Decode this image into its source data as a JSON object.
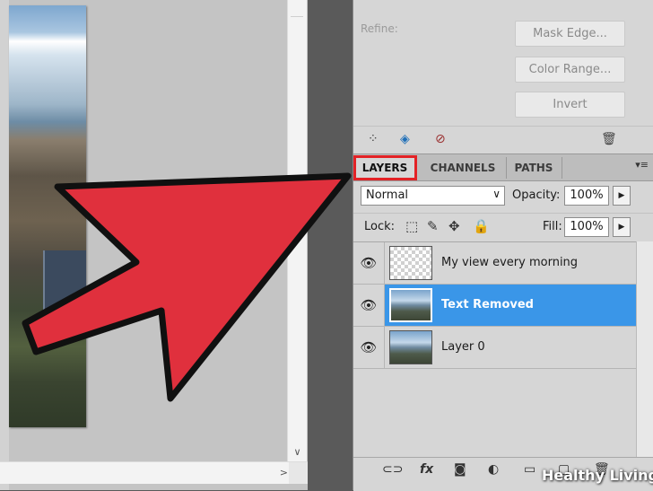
{
  "masks": {
    "refine_label": "Refine:",
    "mask_edge": "Mask Edge...",
    "color_range": "Color Range...",
    "invert": "Invert",
    "footer_icons": [
      "load-selection-icon",
      "apply-mask-icon",
      "disable-mask-icon",
      "trash-icon"
    ]
  },
  "layers_panel": {
    "tabs": [
      {
        "label": "LAYERS",
        "active": true
      },
      {
        "label": "CHANNELS",
        "active": false
      },
      {
        "label": "PATHS",
        "active": false
      }
    ],
    "blend_mode": "Normal",
    "opacity_label": "Opacity:",
    "opacity_value": "100%",
    "lock_label": "Lock:",
    "fill_label": "Fill:",
    "fill_value": "100%",
    "layers": [
      {
        "name": "My view every morning",
        "visible": true,
        "selected": false,
        "thumbnail": "transparent"
      },
      {
        "name": "Text Removed",
        "visible": true,
        "selected": true,
        "thumbnail": "photo"
      },
      {
        "name": "Layer 0",
        "visible": true,
        "selected": false,
        "thumbnail": "photo"
      }
    ],
    "footer_icons": [
      "link-icon",
      "fx-icon",
      "mask-icon",
      "adjustment-icon",
      "folder-icon",
      "new-layer-icon",
      "trash-icon"
    ]
  },
  "annotation": {
    "arrow_color": "#e0303d",
    "highlight_color": "#e32226"
  },
  "watermark": "Healthy Living",
  "colors": {
    "selection": "#3a96e8",
    "panel_bg": "#d6d6d6",
    "canvas_bg": "#c4c4c4"
  }
}
